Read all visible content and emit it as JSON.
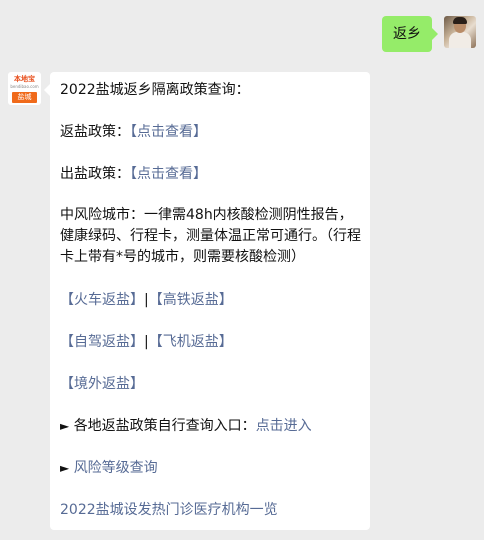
{
  "sent_message": {
    "text": "返乡"
  },
  "bot_avatar": {
    "brand": "本地宝",
    "site": "bendibao.com",
    "city": "盐城"
  },
  "reply": {
    "title": "2022盐城返乡隔离政策查询：",
    "return_policy": {
      "label": "返盐政策：",
      "link": "【点击查看】"
    },
    "exit_policy": {
      "label": "出盐政策：",
      "link": "【点击查看】"
    },
    "medium_risk": "中风险城市：一律需48h内核酸检测阴性报告，健康绿码、行程卡，测量体温正常可通行。（行程卡上带有*号的城市，则需要核酸检测）",
    "links_row1": {
      "a": "【火车返盐】",
      "sep": "|",
      "b": "【高铁返盐】"
    },
    "links_row2": {
      "a": "【自驾返盐】",
      "sep": "|",
      "b": "【飞机返盐】"
    },
    "links_row3": {
      "a": "【境外返盐】"
    },
    "local_entry": {
      "bullet": "►",
      "label": "各地返盐政策自行查询入口：",
      "link": "点击进入"
    },
    "risk_level": {
      "bullet": "►",
      "link": "风险等级查询"
    },
    "fever_clinics": {
      "link": "2022盐城设发热门诊医疗机构一览"
    }
  }
}
